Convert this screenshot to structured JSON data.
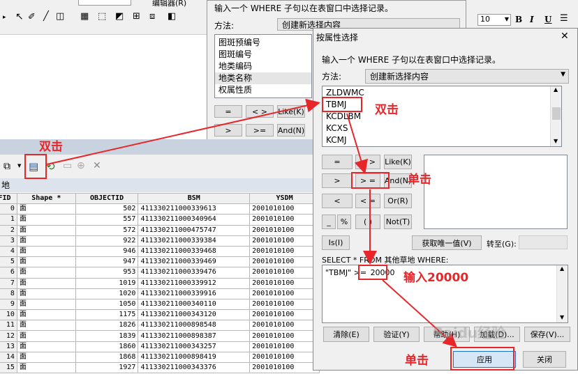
{
  "toolbar": {
    "editor_label": "编辑器(R)",
    "font_size": "10",
    "bold": "B",
    "italic": "I",
    "underline": "U",
    "align_icon": "align-left-icon",
    "font_color": "#000000"
  },
  "bg_dialog": {
    "prompt": "输入一个 WHERE 子句以在表窗口中选择记录。",
    "method_label": "方法:",
    "method_value": "创建新选择内容",
    "fields": [
      "图斑预编号",
      "图斑编号",
      "地类编码",
      "地类名称",
      "权属性质"
    ],
    "ops": [
      "=",
      "< >",
      "Like(K)",
      ">",
      ">=",
      "And(N)"
    ]
  },
  "table_window": {
    "title": "地",
    "columns": [
      "FID",
      "Shape *",
      "OBJECTID",
      "BSM",
      "YSDM"
    ],
    "rows": [
      [
        "0",
        "面",
        "502",
        "411330211000339613",
        "2001010100"
      ],
      [
        "1",
        "面",
        "557",
        "411330211000340964",
        "2001010100"
      ],
      [
        "2",
        "面",
        "572",
        "411330211000475747",
        "2001010100"
      ],
      [
        "3",
        "面",
        "922",
        "411330211000339384",
        "2001010100"
      ],
      [
        "4",
        "面",
        "946",
        "411330211000339468",
        "2001010100"
      ],
      [
        "5",
        "面",
        "947",
        "411330211000339469",
        "2001010100"
      ],
      [
        "6",
        "面",
        "953",
        "411330211000339476",
        "2001010100"
      ],
      [
        "7",
        "面",
        "1019",
        "411330211000339912",
        "2001010100"
      ],
      [
        "8",
        "面",
        "1020",
        "411330211000339916",
        "2001010100"
      ],
      [
        "9",
        "面",
        "1050",
        "411330211000340110",
        "2001010100"
      ],
      [
        "10",
        "面",
        "1175",
        "411330211000343120",
        "2001010100"
      ],
      [
        "11",
        "面",
        "1826",
        "411330211000898548",
        "2001010100"
      ],
      [
        "12",
        "面",
        "1839",
        "411330211000898387",
        "2001010100"
      ],
      [
        "13",
        "面",
        "1860",
        "411330211000343257",
        "2001010100"
      ],
      [
        "14",
        "面",
        "1868",
        "411330211000898419",
        "2001010100"
      ],
      [
        "15",
        "面",
        "1927",
        "411330211000343376",
        "2001010100"
      ]
    ]
  },
  "dialog": {
    "title": "按属性选择",
    "close": "✕",
    "prompt": "输入一个 WHERE 子句以在表窗口中选择记录。",
    "method_label": "方法:",
    "method_value": "创建新选择内容",
    "fields": [
      "ZLDWMC",
      "TBMJ",
      "KCDLBM",
      "KCXS",
      "KCMJ"
    ],
    "ops": {
      "eq": "=",
      "ne": "< >",
      "like": "Like(K)",
      "gt": ">",
      "ge": "> =",
      "and": "And(N)",
      "lt": "<",
      "le": "< =",
      "or": "Or(R)",
      "us": "_",
      "pct": "%",
      "par": "( )",
      "not": "Not(T)",
      "is": "Is(I)"
    },
    "unique_btn": "获取唯一值(V)",
    "goto_label": "转至(G):",
    "select_label": "SELECT * FROM 其他草地 WHERE:",
    "expr_field": "\"TBMJ\" >=",
    "expr_value": "20000",
    "buttons": {
      "clear": "清除(E)",
      "verify": "验证(Y)",
      "help": "帮助(H)",
      "load": "加载(D)...",
      "save": "保存(V)...",
      "apply": "应用",
      "close": "关闭"
    }
  },
  "annotations": {
    "dblclick_1": "双击",
    "dblclick_2": "双击",
    "click_1": "单击",
    "click_2": "单击",
    "input": "输入20000"
  },
  "watermark": "Baidu经验",
  "colors": {
    "annotation": "#e8262a",
    "dialog_bg": "#f0f0f0"
  }
}
